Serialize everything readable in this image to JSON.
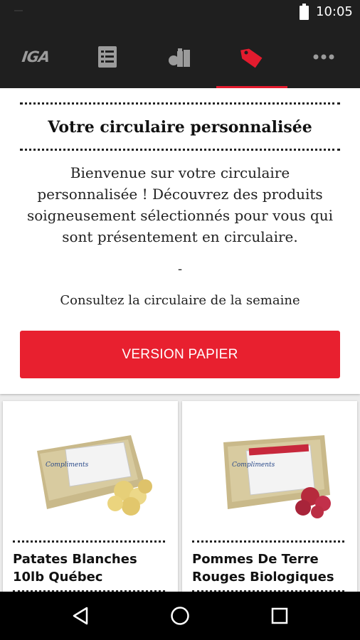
{
  "status_bar": {
    "time": "10:05"
  },
  "top_nav": {
    "logo": "IGA",
    "tabs": [
      {
        "icon": "list-icon"
      },
      {
        "icon": "grocery-icon"
      },
      {
        "icon": "price-tag-icon",
        "active": true
      },
      {
        "icon": "more-icon"
      }
    ],
    "accent_color": "#e31b2e"
  },
  "intro": {
    "title": "Votre circulaire personnalisée",
    "text": "Bienvenue sur votre circulaire personnalisée ! Découvrez des produits soigneusement sélectionnés pour vous qui sont présentement en circulaire.",
    "separator": "-",
    "link_text": "Consultez la circulaire de la semaine",
    "button_label": "VERSION PAPIER",
    "button_color": "#e8202f"
  },
  "products": [
    {
      "name": "Patates Blanches 10lb Québec",
      "image": "white-potatoes-bag-image"
    },
    {
      "name": "Pommes De Terre Rouges Biologiques",
      "image": "red-potatoes-bag-image"
    }
  ],
  "nav_bar": {
    "icons": [
      "back-icon",
      "home-icon",
      "recents-icon"
    ]
  }
}
